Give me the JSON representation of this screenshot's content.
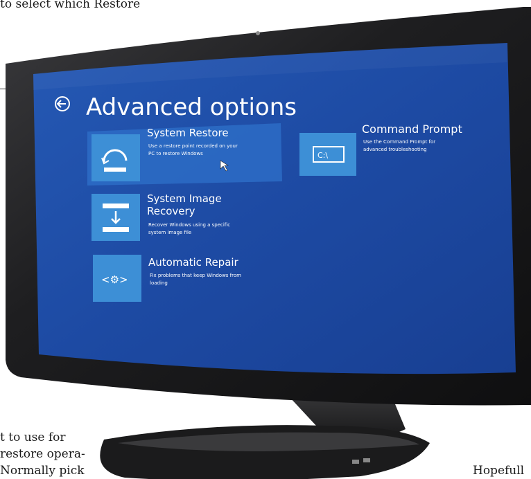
{
  "article": {
    "line_top": "to select which Restore",
    "line_left_1": "t to use for",
    "line_left_2": "restore opera-",
    "line_left_3": "Normally pick",
    "line_right": "Hopefull"
  },
  "screen": {
    "title": "Advanced options",
    "back_icon": "back-arrow-icon",
    "tiles": [
      {
        "id": "system-restore",
        "icon": "restore-icon",
        "title": "System Restore",
        "description_1": "Use a restore point recorded on your",
        "description_2": "PC to restore Windows"
      },
      {
        "id": "command-prompt",
        "icon": "command-prompt-icon",
        "icon_text": "C:\\",
        "title": "Command Prompt",
        "description_1": "Use the Command Prompt for",
        "description_2": "advanced troubleshooting"
      },
      {
        "id": "system-image-recovery",
        "icon": "image-recovery-icon",
        "title_1": "System Image",
        "title_2": "Recovery",
        "description_1": "Recover Windows using a specific",
        "description_2": "system image file"
      },
      {
        "id": "automatic-repair",
        "icon": "repair-icon",
        "icon_text": "<⚙>",
        "title": "Automatic Repair",
        "description_1": "Fix problems that keep Windows from",
        "description_2": "loading"
      }
    ]
  },
  "colors": {
    "screen_blue": "#1f4fa8",
    "tile_blue": "#3d8fd6",
    "bezel": "#1b1b1d",
    "stand": "#2a2a2c"
  }
}
